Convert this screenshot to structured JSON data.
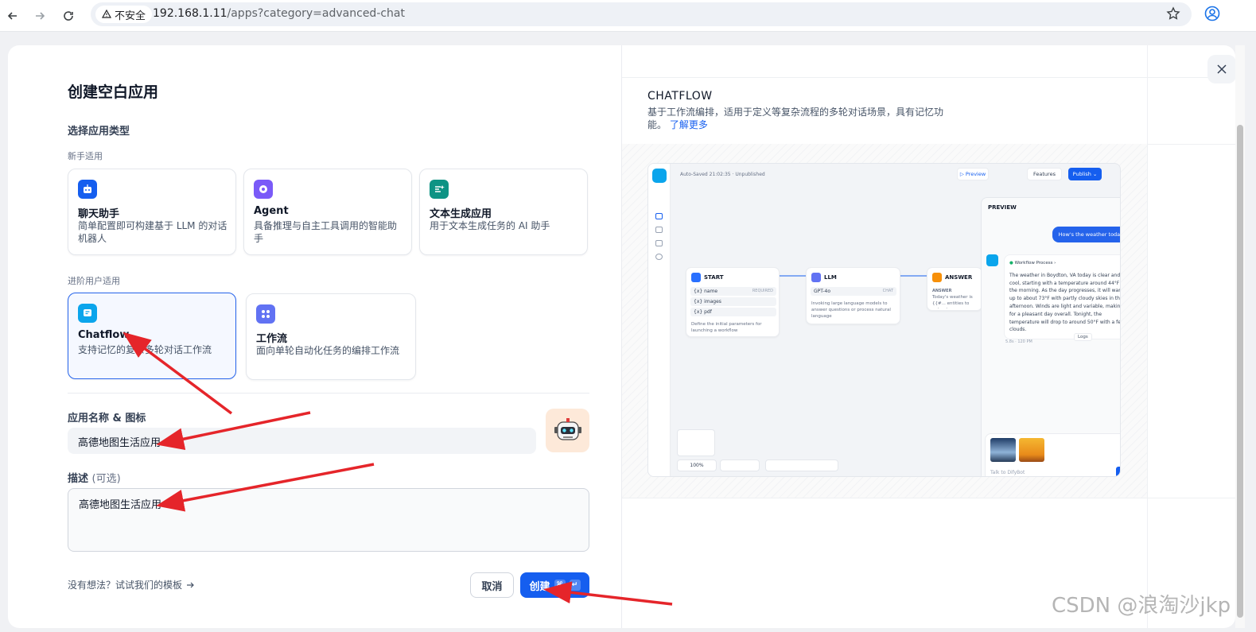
{
  "browser": {
    "insecure_label": "不安全",
    "url_host": "192.168.1.11",
    "url_path": "/apps?category=advanced-chat"
  },
  "dialog": {
    "title": "创建空白应用",
    "app_type_label": "选择应用类型",
    "beginner_label": "新手适用",
    "advanced_label": "进阶用户适用",
    "beginner_cards": [
      {
        "title": "聊天助手",
        "desc": "简单配置即可构建基于 LLM 的对话机器人",
        "color": "#155eef"
      },
      {
        "title": "Agent",
        "desc": "具备推理与自主工具调用的智能助手",
        "color": "#7a5af8"
      },
      {
        "title": "文本生成应用",
        "desc": "用于文本生成任务的 AI 助手",
        "color": "#0e9384"
      }
    ],
    "advanced_cards": [
      {
        "title": "Chatflow",
        "desc": "支持记忆的复杂多轮对话工作流",
        "color": "#0ba5ec"
      },
      {
        "title": "工作流",
        "desc": "面向单轮自动化任务的编排工作流",
        "color": "#6172f3"
      }
    ],
    "name_label": "应用名称 & 图标",
    "name_value": "高德地图生活应用",
    "desc_label": "描述",
    "desc_optional": "(可选)",
    "desc_value": "高德地图生活应用",
    "templates_link": "没有想法？试试我们的模板",
    "cancel": "取消",
    "create": "创建",
    "create_kbd1": "⌘",
    "create_kbd2": "↵"
  },
  "preview_panel": {
    "title": "CHATFLOW",
    "desc": "基于工作流编排，适用于定义等复杂流程的多轮对话场景，具有记忆功能。",
    "learn_more": "了解更多",
    "shot": {
      "autosaved": "Auto-Saved 21:02:35 · Unpublished",
      "preview_btn": "▷ Preview",
      "features_btn": "Features",
      "publish_btn": "Publish ⌄",
      "nodes": {
        "start": {
          "title": "START",
          "rows": [
            "{x} name",
            "{x} images",
            "{x} pdf"
          ],
          "required": "REQUIRED",
          "desc": "Define the initial parameters for launching a workflow"
        },
        "llm": {
          "title": "LLM",
          "model": "GPT-4o",
          "mode": "CHAT",
          "desc": "Invoking large language models to answer questions or process natural language"
        },
        "answer": {
          "title": "ANSWER",
          "sub": "ANSWER",
          "desc": "Today's weather is {{#... entities to extract."
        }
      },
      "zoom": "100%",
      "preview": {
        "title": "PREVIEW",
        "user_msg": "How's the weather today",
        "workflow_label": "Workflow Process",
        "bot_msg": "The weather in Boydton, VA today is clear and cool, starting with a temperature around 44°F in the morning. As the day progresses, it will warm up to about 73°F with partly cloudy skies in the afternoon. Winds are light and variable, making for a pleasant day overall. Tonight, the temperature will drop to around 50°F with a few clouds.",
        "meta": "5.8s · 120 PM",
        "logs": "Logs",
        "input_placeholder": "Talk to DifyBot"
      }
    }
  },
  "watermark": "CSDN @浪淘沙jkp"
}
